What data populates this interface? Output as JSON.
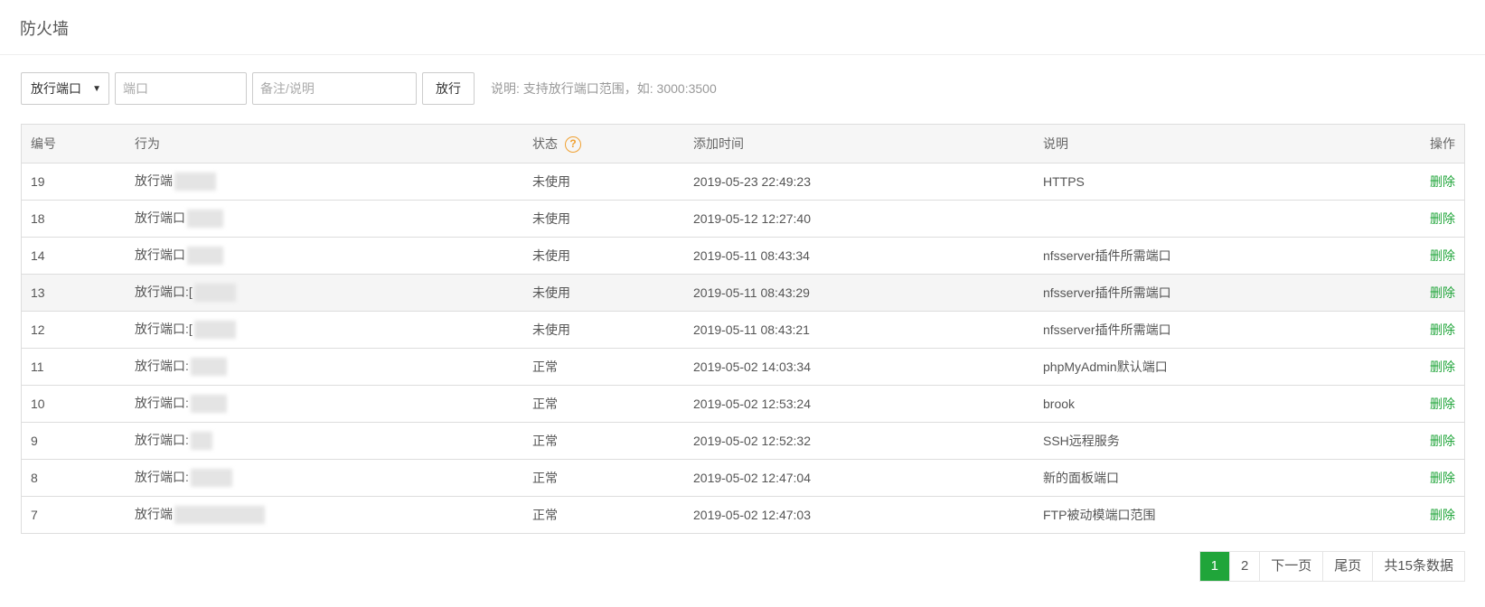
{
  "title": "防火墙",
  "toolbar": {
    "select_value": "放行端口",
    "port_placeholder": "端口",
    "note_placeholder": "备注/说明",
    "submit_label": "放行",
    "hint": "说明: 支持放行端口范围，如: 3000:3500"
  },
  "table": {
    "headers": {
      "id": "编号",
      "action": "行为",
      "status": "状态",
      "time": "添加时间",
      "desc": "说明",
      "op": "操作"
    },
    "rows": [
      {
        "id": "19",
        "action": "放行端",
        "status": "未使用",
        "time": "2019-05-23 22:49:23",
        "desc": "HTTPS",
        "op": "删除"
      },
      {
        "id": "18",
        "action": "放行端口",
        "status": "未使用",
        "time": "2019-05-12 12:27:40",
        "desc": "",
        "op": "删除"
      },
      {
        "id": "14",
        "action": "放行端口",
        "status": "未使用",
        "time": "2019-05-11 08:43:34",
        "desc": "nfsserver插件所需端口",
        "op": "删除"
      },
      {
        "id": "13",
        "action": "放行端口:[",
        "status": "未使用",
        "time": "2019-05-11 08:43:29",
        "desc": "nfsserver插件所需端口",
        "op": "删除"
      },
      {
        "id": "12",
        "action": "放行端口:[",
        "status": "未使用",
        "time": "2019-05-11 08:43:21",
        "desc": "nfsserver插件所需端口",
        "op": "删除"
      },
      {
        "id": "11",
        "action": "放行端口:",
        "status": "正常",
        "time": "2019-05-02 14:03:34",
        "desc": "phpMyAdmin默认端口",
        "op": "删除"
      },
      {
        "id": "10",
        "action": "放行端口:",
        "status": "正常",
        "time": "2019-05-02 12:53:24",
        "desc": "brook",
        "op": "删除"
      },
      {
        "id": "9",
        "action": "放行端口:",
        "status": "正常",
        "time": "2019-05-02 12:52:32",
        "desc": "SSH远程服务",
        "op": "删除"
      },
      {
        "id": "8",
        "action": "放行端口:",
        "status": "正常",
        "time": "2019-05-02 12:47:04",
        "desc": "新的面板端口",
        "op": "删除"
      },
      {
        "id": "7",
        "action": "放行端",
        "status": "正常",
        "time": "2019-05-02 12:47:03",
        "desc": "FTP被动模端口范围",
        "op": "删除"
      }
    ]
  },
  "pager": {
    "current": "1",
    "page2": "2",
    "next": "下一页",
    "last": "尾页",
    "total": "共15条数据"
  },
  "icons": {
    "status_help": "question-circle-icon"
  },
  "colors": {
    "accent": "#20a53a",
    "warning": "#f0a030"
  }
}
